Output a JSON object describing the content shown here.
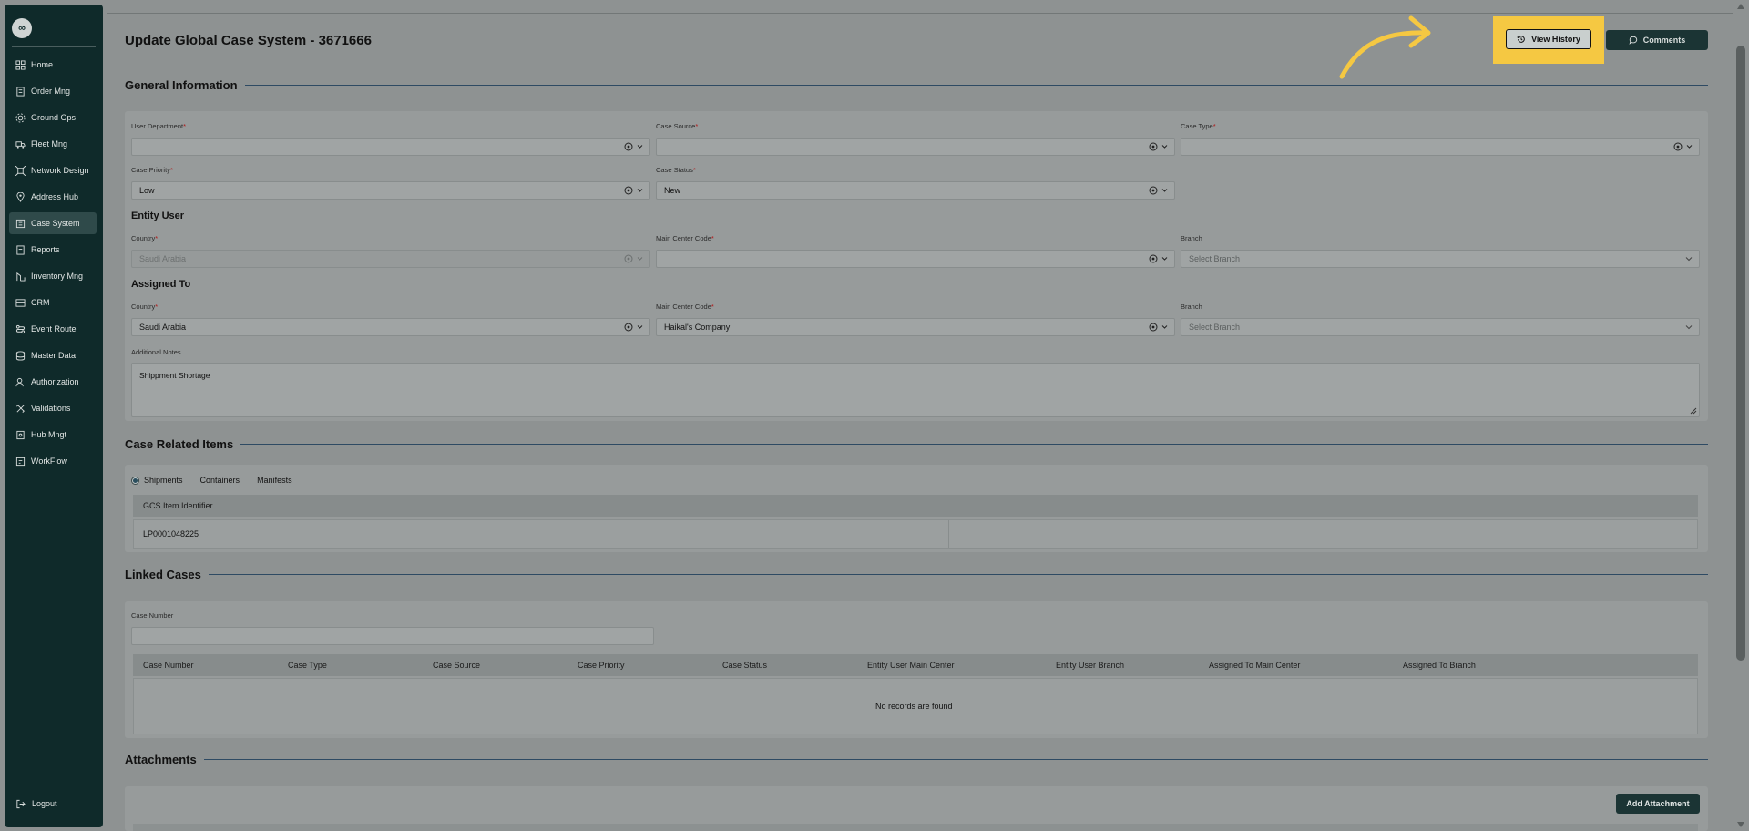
{
  "sidebar": {
    "logo": "∞",
    "items": [
      {
        "label": "Home",
        "icon": "home-icon"
      },
      {
        "label": "Order Mng",
        "icon": "order-icon"
      },
      {
        "label": "Ground Ops",
        "icon": "ground-ops-icon"
      },
      {
        "label": "Fleet Mng",
        "icon": "truck-icon"
      },
      {
        "label": "Network Design",
        "icon": "network-icon"
      },
      {
        "label": "Address Hub",
        "icon": "address-icon"
      },
      {
        "label": "Case System",
        "icon": "case-icon",
        "active": true
      },
      {
        "label": "Reports",
        "icon": "reports-icon"
      },
      {
        "label": "Inventory Mng",
        "icon": "inventory-icon"
      },
      {
        "label": "CRM",
        "icon": "crm-icon"
      },
      {
        "label": "Event Route",
        "icon": "route-icon"
      },
      {
        "label": "Master Data",
        "icon": "database-icon"
      },
      {
        "label": "Authorization",
        "icon": "user-icon"
      },
      {
        "label": "Validations",
        "icon": "validations-icon"
      },
      {
        "label": "Hub Mngt",
        "icon": "hub-icon"
      },
      {
        "label": "WorkFlow",
        "icon": "workflow-icon"
      }
    ],
    "logout": "Logout"
  },
  "header": {
    "title": "Update Global Case System - 3671666",
    "view_history": "View History",
    "comments": "Comments"
  },
  "general": {
    "heading": "General Information",
    "user_department": {
      "label": "User Department",
      "value": ""
    },
    "case_source": {
      "label": "Case Source",
      "value": ""
    },
    "case_type": {
      "label": "Case Type",
      "value": ""
    },
    "case_priority": {
      "label": "Case Priority",
      "value": "Low"
    },
    "case_status": {
      "label": "Case Status",
      "value": "New"
    },
    "entity_user": {
      "heading": "Entity User",
      "country_label": "Country",
      "country_value": "Saudi Arabia",
      "main_center_label": "Main Center Code",
      "main_center_value": "",
      "branch_label": "Branch",
      "branch_placeholder": "Select Branch"
    },
    "assigned_to": {
      "heading": "Assigned To",
      "country_label": "Country",
      "country_value": "Saudi Arabia",
      "main_center_label": "Main Center Code",
      "main_center_value": "Haikal's Company",
      "branch_label": "Branch",
      "branch_placeholder": "Select Branch"
    },
    "notes_label": "Additional Notes",
    "notes_value": "Shippment Shortage"
  },
  "related": {
    "heading": "Case Related Items",
    "tabs": [
      "Shipments",
      "Containers",
      "Manifests"
    ],
    "column": "GCS Item Identifier",
    "rows": [
      "LP0001048225"
    ]
  },
  "linked": {
    "heading": "Linked Cases",
    "case_number_label": "Case Number",
    "case_number_value": "",
    "columns": [
      "Case Number",
      "Case Type",
      "Case Source",
      "Case Priority",
      "Case Status",
      "Entity User Main Center",
      "Entity User Branch",
      "Assigned To Main Center",
      "Assigned To Branch"
    ],
    "empty": "No records are found"
  },
  "attachments": {
    "heading": "Attachments",
    "add_button": "Add Attachment"
  },
  "colors": {
    "sidebar_bg": "#0f2a2a",
    "highlight": "#f5c842",
    "section_rule": "#2e4a63"
  }
}
